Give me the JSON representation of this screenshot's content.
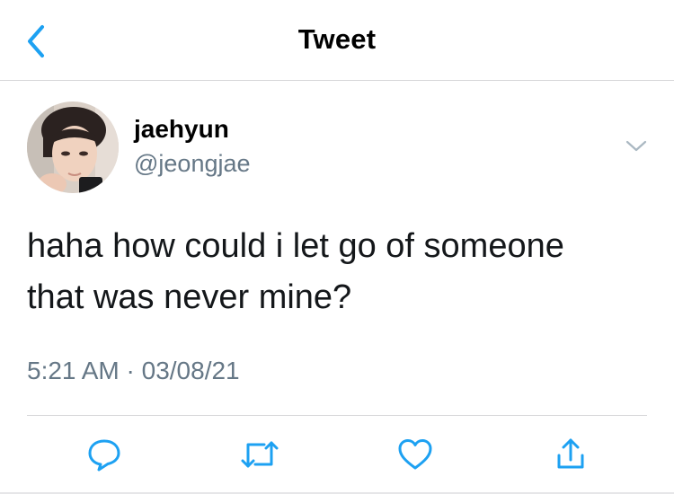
{
  "header": {
    "title": "Tweet",
    "back_icon": "chevron-left-icon",
    "accent_color": "#1da1f2"
  },
  "tweet": {
    "author": {
      "display_name": "jaehyun",
      "handle": "@jeongjae",
      "avatar_icon": "profile-photo"
    },
    "text_line1": "haha how could i let go of someone",
    "text_line2": "that was never mine?",
    "time": "5:21 AM",
    "separator": " · ",
    "date": "03/08/21",
    "more_icon": "chevron-down-icon"
  },
  "actions": [
    {
      "name": "reply",
      "icon": "comment-icon"
    },
    {
      "name": "retweet",
      "icon": "retweet-icon"
    },
    {
      "name": "like",
      "icon": "heart-icon"
    },
    {
      "name": "share",
      "icon": "share-icon"
    }
  ],
  "colors": {
    "text": "#14171a",
    "secondary_text": "#657786",
    "divider": "#d6d6d8"
  }
}
